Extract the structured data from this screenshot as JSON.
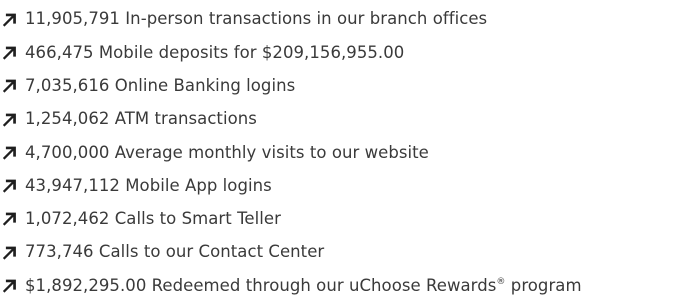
{
  "colors": {
    "text": "#3a3a3a",
    "arrow": "#1f1f1f"
  },
  "icon": "arrow-up-right-icon",
  "stats": [
    {
      "text": "11,905,791 In-person transactions in our branch offices"
    },
    {
      "text": "466,475 Mobile deposits for $209,156,955.00"
    },
    {
      "text": "7,035,616 Online Banking logins"
    },
    {
      "text": "1,254,062 ATM transactions"
    },
    {
      "text": "4,700,000 Average monthly visits to our website"
    },
    {
      "text": "43,947,112 Mobile App logins"
    },
    {
      "text": "1,072,462 Calls to Smart Teller"
    },
    {
      "text": "773,746 Calls to our Contact Center"
    },
    {
      "text": "$1,892,295.00 Redeemed through our uChoose Rewards",
      "suffix_mark": "®",
      "suffix_text": " program"
    }
  ]
}
